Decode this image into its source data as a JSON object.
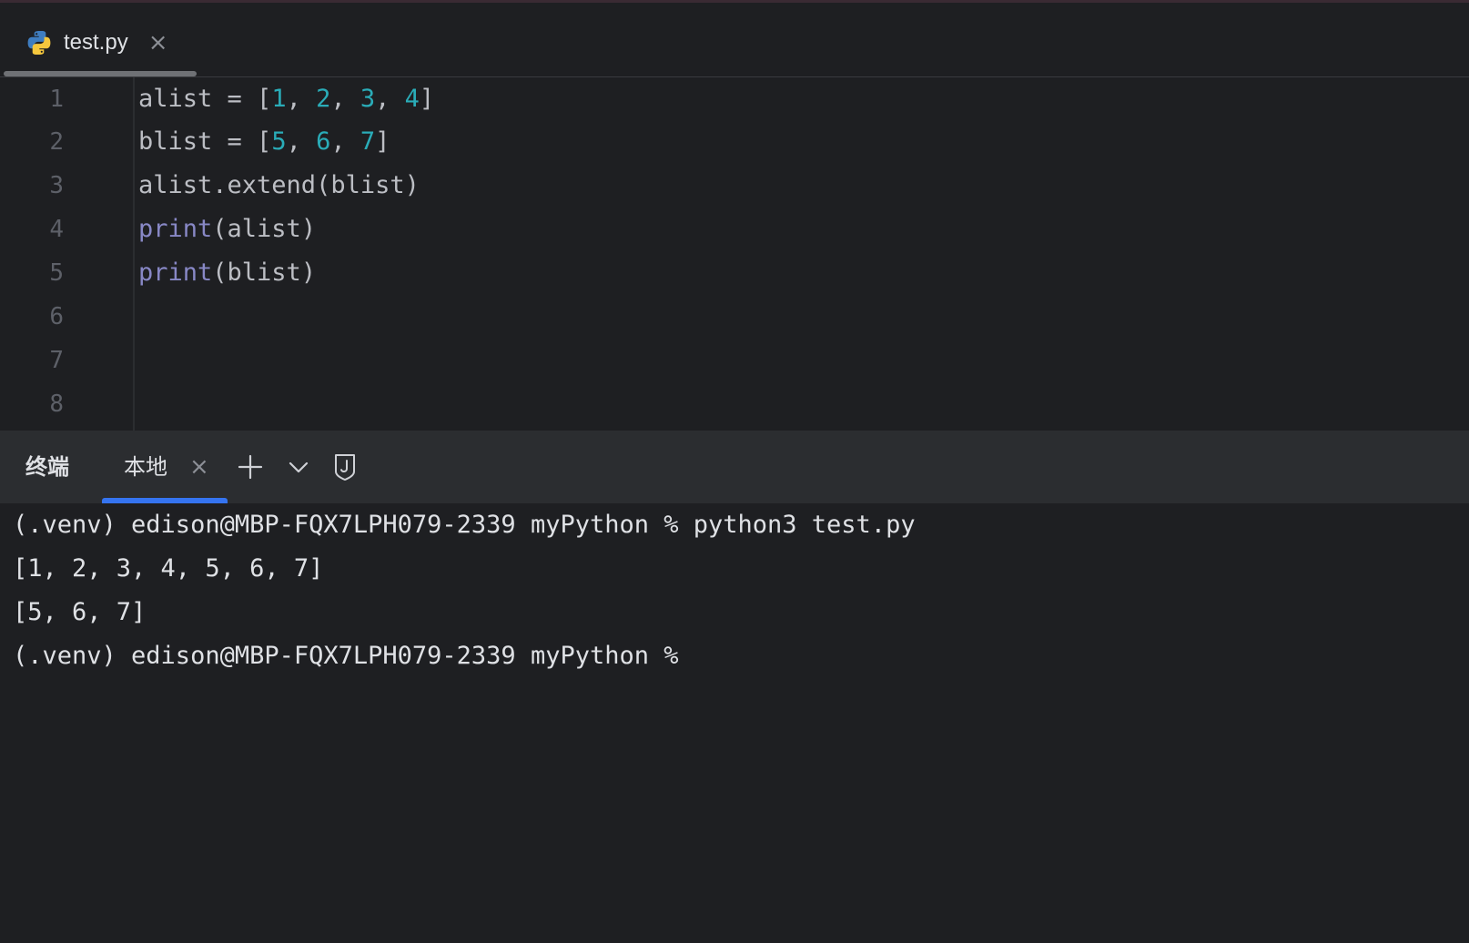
{
  "editor_tab": {
    "file_name": "test.py",
    "icon": "python-icon",
    "close": "×"
  },
  "editor": {
    "line_numbers": [
      "1",
      "2",
      "3",
      "4",
      "5",
      "6",
      "7",
      "8"
    ],
    "lines": [
      [
        "alist = [",
        "1",
        ", ",
        "2",
        ", ",
        "3",
        ", ",
        "4",
        "]"
      ],
      [
        "blist = [",
        "5",
        ", ",
        "6",
        ", ",
        "7",
        "]"
      ],
      [
        "alist.extend(blist)"
      ],
      [
        "print",
        "(alist)"
      ],
      [
        "print",
        "(blist)"
      ]
    ],
    "colors": {
      "text": "#bcbec4",
      "number": "#2aacb8",
      "builtin": "#8888c6"
    }
  },
  "terminal_panel": {
    "title": "终端",
    "active_tab": "本地",
    "tab_close": "×",
    "icons": [
      "plus-icon",
      "chevron-down-icon",
      "shield-icon"
    ],
    "accent": "#3574f0"
  },
  "terminal": {
    "lines": [
      "(.venv) edison@MBP-FQX7LPH079-2339 myPython % python3 test.py",
      "[1, 2, 3, 4, 5, 6, 7]",
      "[5, 6, 7]",
      "(.venv) edison@MBP-FQX7LPH079-2339 myPython %"
    ]
  }
}
